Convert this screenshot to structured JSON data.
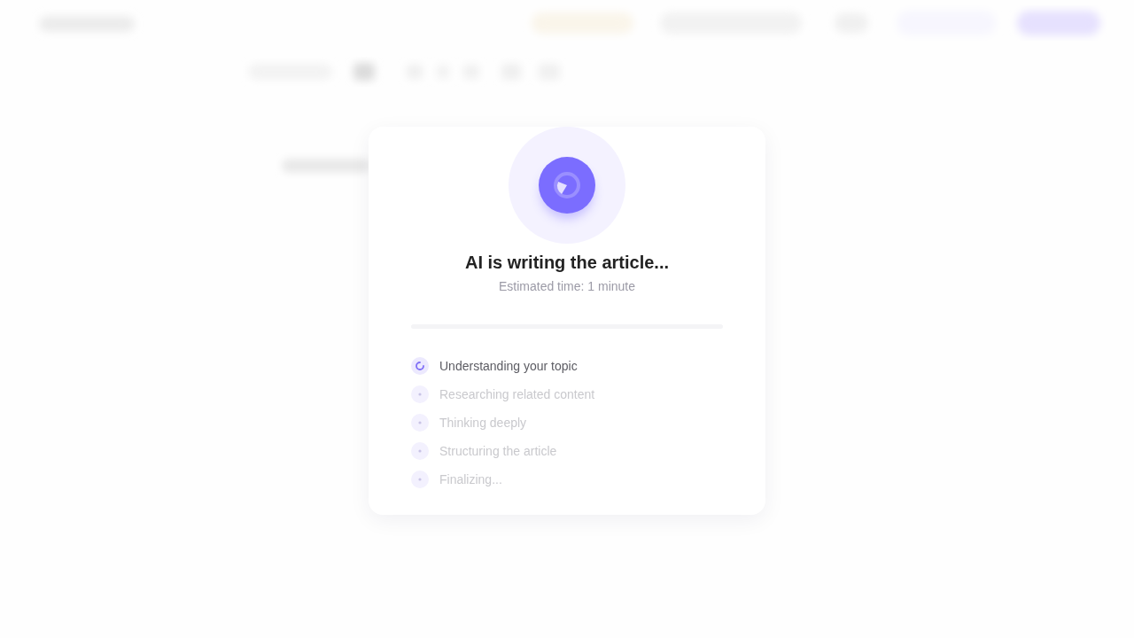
{
  "dialog": {
    "title": "AI is writing the article...",
    "subtitle": "Estimated time: 1 minute",
    "progress": {
      "level": 0
    },
    "steps": [
      {
        "label": "Understanding your topic",
        "active": true
      },
      {
        "label": "Researching related content",
        "active": false
      },
      {
        "label": "Thinking deeply",
        "active": false
      },
      {
        "label": "Structuring the article",
        "active": false
      },
      {
        "label": "Finalizing...",
        "active": false
      }
    ]
  }
}
